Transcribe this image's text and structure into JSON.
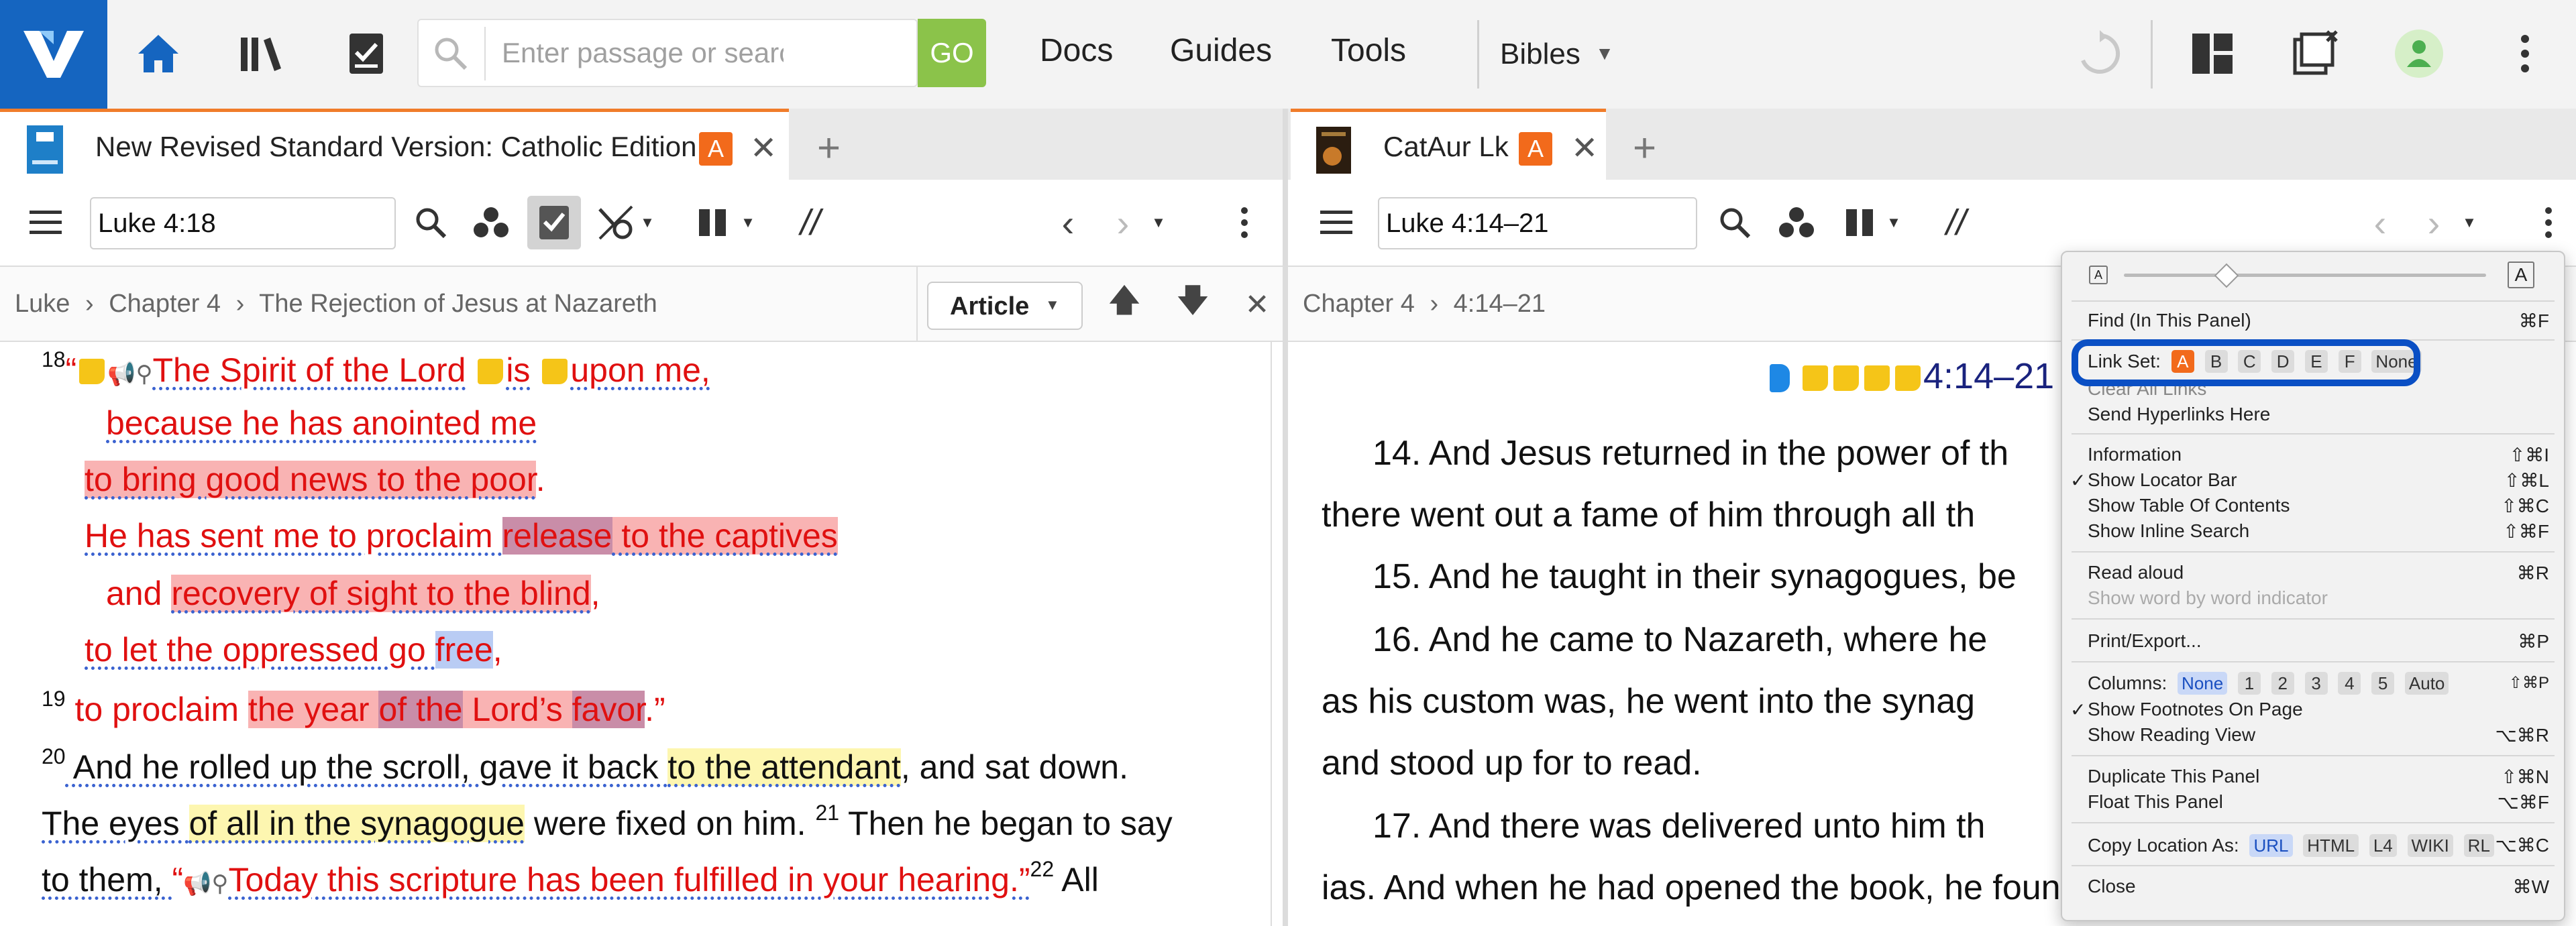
{
  "app": {
    "search_placeholder": "Enter passage or search",
    "go_label": "GO",
    "nav": [
      "Docs",
      "Guides",
      "Tools"
    ],
    "bibles_label": "Bibles",
    "accent": "#1565c0",
    "go_color": "#8bc34a"
  },
  "left_panel": {
    "tab_title": "New Revised Standard Version: Catholic Edition",
    "tab_badge": "A",
    "reference": "Luke 4:18",
    "breadcrumb": [
      "Luke",
      "Chapter 4",
      "The Rejection of Jesus at Nazareth"
    ],
    "article_label": "Article",
    "lines": {
      "l1_num": "18",
      "l1_a": "“",
      "l1_b": "The Spirit of the Lord",
      "l1_c": "is",
      "l1_d": "upon me,",
      "l2": "because he has anointed me",
      "l3_a": "to bring good news to the poor",
      "l3_b": ".",
      "l4_a": "He has sent me to proclaim ",
      "l4_b": "release",
      "l4_c": " to the captives",
      "l5_a": "and ",
      "l5_b": "recovery of sight to the blind",
      "l5_c": ",",
      "l6_a": "to let the oppressed go ",
      "l6_b": "free",
      "l6_c": ",",
      "l7_num": "19",
      "l7_a": " to proclaim ",
      "l7_b": "the year ",
      "l7_c": "of the",
      "l7_d": " Lord’s ",
      "l7_e": "favor",
      "l7_f": ".”",
      "l8_num": "20",
      "l8_a": " And he rolled up the scroll, gave it back ",
      "l8_b": "to the attendant",
      "l8_c": ", and sat down.",
      "l9_a": "The eyes ",
      "l9_b": "of all in the synagogue",
      "l9_c": " were fixed on him. ",
      "l9_num": "21",
      "l9_d": " Then he began to say",
      "l10_a": "to them, ",
      "l10_b": "“",
      "l10_c": "Today this scripture has been fulfilled in your hearing.”",
      "l10_num": "22",
      "l10_d": " All"
    }
  },
  "right_panel": {
    "tab_title": "CatAur Lk",
    "tab_badge": "A",
    "reference": "Luke 4:14–21",
    "breadcrumb": [
      "Chapter 4",
      "4:14–21"
    ],
    "heading": "4:14–21",
    "lines": [
      "14. And Jesus returned in the power of th",
      "there went out a fame of him through all th",
      "15. And he taught in their synagogues, be",
      "16. And he came to Nazareth, where he",
      "as his custom was, he went into the synag",
      "and stood up for to read.",
      "17. And there was delivered unto him th",
      "ias. And when he had opened the book, he found the place where it"
    ]
  },
  "menu": {
    "font_small": "A",
    "font_large": "A",
    "find": "Find (In This Panel)",
    "find_sc": "⌘F",
    "link_set_label": "Link Set:",
    "link_sets": [
      "A",
      "B",
      "C",
      "D",
      "E",
      "F",
      "None"
    ],
    "clear_links": "Clear All Links",
    "send_hyperlinks": "Send Hyperlinks Here",
    "information": "Information",
    "information_sc": "⇧⌘I",
    "locator_bar": "Show Locator Bar",
    "locator_bar_sc": "⇧⌘L",
    "toc": "Show Table Of Contents",
    "toc_sc": "⇧⌘C",
    "inline_search": "Show Inline Search",
    "inline_search_sc": "⇧⌘F",
    "read_aloud": "Read aloud",
    "read_aloud_sc": "⌘R",
    "word_indicator": "Show word by word indicator",
    "print": "Print/Export...",
    "print_sc": "⌘P",
    "columns_label": "Columns:",
    "columns": [
      "None",
      "1",
      "2",
      "3",
      "4",
      "5",
      "Auto"
    ],
    "columns_sc": "⇧⌘P",
    "footnotes": "Show Footnotes On Page",
    "reading_view": "Show Reading View",
    "reading_view_sc": "⌥⌘R",
    "duplicate": "Duplicate This Panel",
    "duplicate_sc": "⇧⌘N",
    "float": "Float This Panel",
    "float_sc": "⌥⌘F",
    "copy_location_label": "Copy Location As:",
    "copy_formats": [
      "URL",
      "HTML",
      "L4",
      "WIKI",
      "RL"
    ],
    "copy_sc": "⌥⌘C",
    "close": "Close",
    "close_sc": "⌘W",
    "checkmark": "✓"
  }
}
